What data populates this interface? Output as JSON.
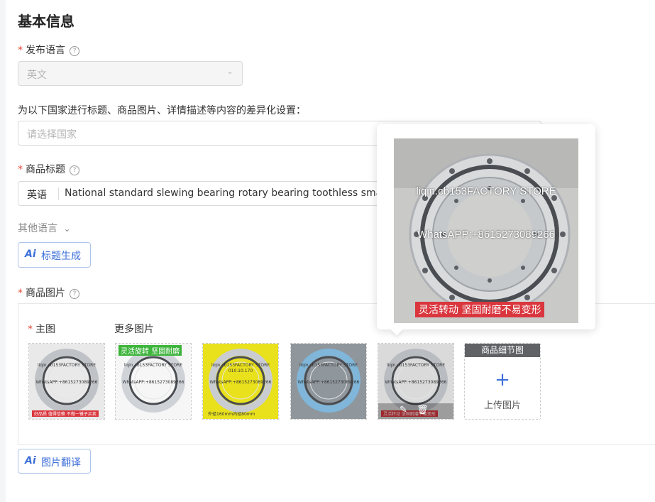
{
  "section_title": "基本信息",
  "publish_language": {
    "label": "发布语言",
    "help": "?",
    "value": "英文"
  },
  "country": {
    "label": "为以下国家进行标题、商品图片、详情描述等内容的差异化设置：",
    "placeholder": "请选择国家"
  },
  "product_title": {
    "label": "商品标题",
    "help": "?",
    "language_prefix": "英语",
    "value": "National standard slewing bearing rotary bearing toothless small"
  },
  "other_language": {
    "label": "其他语言"
  },
  "ai_title_button": {
    "icon": "Ai",
    "label": "标题生成"
  },
  "product_images": {
    "label": "商品图片",
    "help": "?",
    "main_label": "主图",
    "more_label": "更多图片",
    "thumbnails": [
      {
        "line1": "liqin.cb153FACTORY STORE",
        "line2": "WhatsAPP:+8615273089266",
        "banner": "好品质 值得信赖 不做一锤子买卖",
        "bg": "#e9e9e9",
        "ring": "#bfc2c6",
        "banner_color": "#d9363e"
      },
      {
        "line1": "liqin.cb153FACTORY STORE",
        "line2": "WhatsAPP:+8615273089266",
        "banner": "灵活旋转 坚固耐磨",
        "bg": "#f6f6f6",
        "ring": "#cfd3d8",
        "banner_color": "#3db43b"
      },
      {
        "line1": "liqin.cb153FACTORY STORE",
        "line2": "WhatsAPP:+8615273089266",
        "mid": "010.10.170",
        "banner": "外径160mm内径80mm",
        "bg": "#e9e11c",
        "ring": "#c9ccd0",
        "banner_color": "#333333"
      },
      {
        "line1": "liqin.cb153FACTORY STORE",
        "line2": "WhatsAPP:+8615273089266",
        "banner": "",
        "bg": "#8f969c",
        "ring": "#7fb6d9",
        "banner_color": "#2e9e4a"
      },
      {
        "line1": "liqin.cb153FACTORY STORE",
        "line2": "WhatsAPP:+8615273089266",
        "banner": "灵活转动 坚固耐磨不易变形",
        "bg": "#dadada",
        "ring": "#b9bcc0",
        "banner_color": "#d9363e"
      }
    ],
    "detail_label": "商品细节图",
    "upload_plus": "+",
    "upload_label": "上传图片"
  },
  "preview": {
    "line1": "liqin.cb153FACTORY STORE",
    "line2": "WhatsAPP:+8615273089266",
    "banner": "灵活转动 坚固耐磨不易变形"
  },
  "ai_translate_button": {
    "icon": "Ai",
    "label": "图片翻译"
  },
  "colors": {
    "accent": "#3b6ed8",
    "required": "#e64b3c"
  }
}
